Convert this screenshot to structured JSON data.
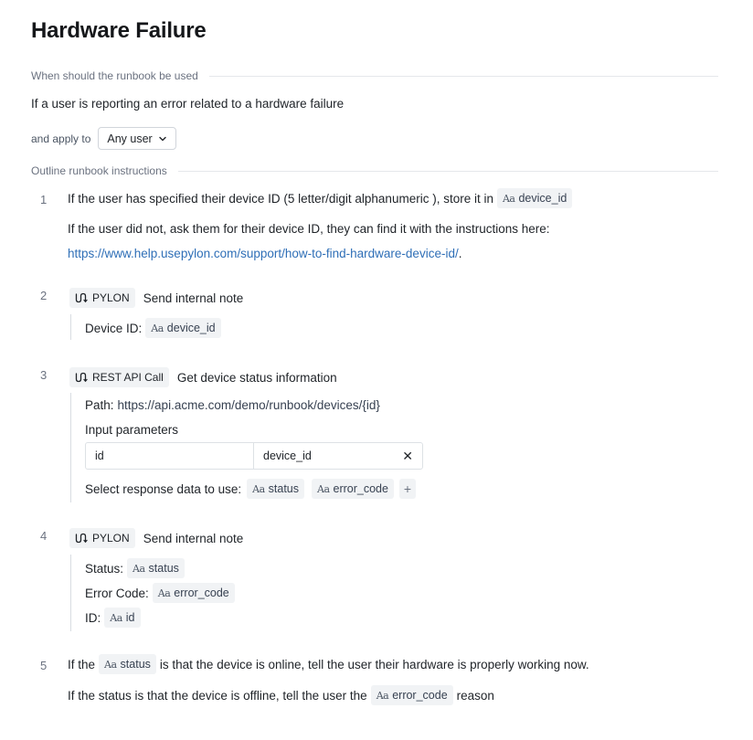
{
  "title": "Hardware Failure",
  "usage": {
    "label": "When should the runbook be used",
    "text": "If a user is reporting an error related to a hardware failure"
  },
  "apply": {
    "label": "and apply to",
    "value": "Any user"
  },
  "instructions_label": "Outline runbook instructions",
  "steps": {
    "s1": {
      "num": "1",
      "line1_prefix": "If the user has specified their device ID (5 letter/digit alphanumeric ), store it in",
      "line1_var": "device_id",
      "line2": "If the user did not, ask them for their device ID, they can find it with the instructions here:",
      "link": "https://www.help.usepylon.com/support/how-to-find-hardware-device-id/",
      "link_suffix": "."
    },
    "s2": {
      "num": "2",
      "tag": "PYLON",
      "action": "Send internal note",
      "field_label": "Device ID:",
      "field_var": "device_id"
    },
    "s3": {
      "num": "3",
      "tag": "REST API Call",
      "action": "Get device status information",
      "path_label": "Path:",
      "path_value": "https://api.acme.com/demo/runbook/devices/{id}",
      "params_label": "Input parameters",
      "param_key": "id",
      "param_value": "device_id",
      "response_label": "Select response data to use:",
      "response_vars": [
        "status",
        "error_code"
      ],
      "add_symbol": "+"
    },
    "s4": {
      "num": "4",
      "tag": "PYLON",
      "action": "Send internal note",
      "status_label": "Status:",
      "status_var": "status",
      "error_label": "Error Code:",
      "error_var": "error_code",
      "id_label": "ID:",
      "id_var": "id"
    },
    "s5": {
      "num": "5",
      "line1_prefix": "If the",
      "line1_var": "status",
      "line1_suffix": "is that the device is online, tell the user their hardware is properly working now.",
      "line2_prefix": "If the status is that the device is offline, tell the user the",
      "line2_var": "error_code",
      "line2_suffix": "reason"
    }
  },
  "var_icon_text": "Aa",
  "close_symbol": "✕",
  "colors": {
    "link": "#2f6fb7",
    "chip_bg": "#f1f3f5",
    "muted": "#6b7280"
  }
}
